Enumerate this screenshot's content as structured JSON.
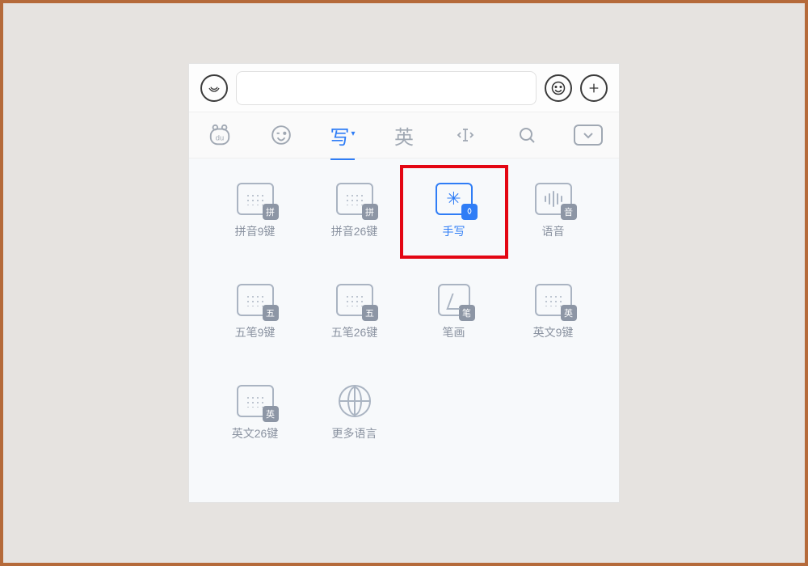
{
  "topbar": {
    "voice_icon": "voice",
    "emoji_icon": "emoji",
    "plus_icon": "plus"
  },
  "toolbar": {
    "logo": "du",
    "emoji": "emoji",
    "write_label": "写",
    "english_label": "英",
    "cursor": "cursor",
    "search": "search",
    "collapse": "collapse"
  },
  "methods": [
    {
      "id": "pinyin9",
      "label": "拼音9键",
      "badge": "拼",
      "icon": "keyboard",
      "active": false
    },
    {
      "id": "pinyin26",
      "label": "拼音26键",
      "badge": "拼",
      "icon": "keyboard",
      "active": false
    },
    {
      "id": "handwriting",
      "label": "手写",
      "badge": "✎",
      "icon": "star",
      "active": true,
      "highlighted": true
    },
    {
      "id": "voice",
      "label": "语音",
      "badge": "音",
      "icon": "wave",
      "active": false
    },
    {
      "id": "wubi9",
      "label": "五笔9键",
      "badge": "五",
      "icon": "keyboard",
      "active": false
    },
    {
      "id": "wubi26",
      "label": "五笔26键",
      "badge": "五",
      "icon": "keyboard",
      "active": false
    },
    {
      "id": "stroke",
      "label": "笔画",
      "badge": "笔",
      "icon": "stroke",
      "active": false
    },
    {
      "id": "english9",
      "label": "英文9键",
      "badge": "英",
      "icon": "keyboard",
      "active": false
    },
    {
      "id": "english26",
      "label": "英文26键",
      "badge": "英",
      "icon": "keyboard",
      "active": false
    },
    {
      "id": "more",
      "label": "更多语言",
      "badge": "",
      "icon": "globe",
      "active": false
    }
  ]
}
